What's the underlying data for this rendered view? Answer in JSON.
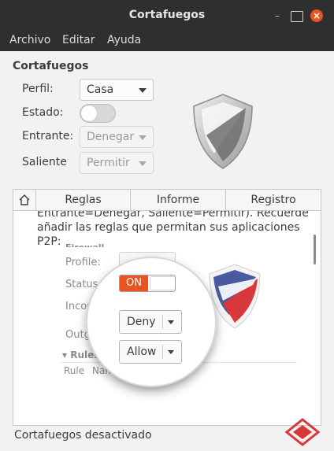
{
  "window": {
    "title": "Cortafuegos",
    "minimize_glyph": "–",
    "close_glyph": "×"
  },
  "menu": {
    "items": [
      "Archivo",
      "Editar",
      "Ayuda"
    ]
  },
  "settings": {
    "section_title": "Cortafuegos",
    "profile_label": "Perfil:",
    "profile_value": "Casa",
    "status_label": "Estado:",
    "status_on": false,
    "incoming_label": "Entrante:",
    "incoming_value": "Denegar",
    "outgoing_label": "Saliente",
    "outgoing_value": "Permitir"
  },
  "tabs": {
    "home_icon": "home-icon",
    "items": [
      "Reglas",
      "Informe",
      "Registro"
    ]
  },
  "panel": {
    "lines": [
      "Entrante=Denegar, Saliente=Permitir). Recuerde",
      "añadir las reglas que permitan sus aplicaciones",
      "P2P:"
    ],
    "embedded_screenshot": {
      "heading": "Firewall",
      "profile_label": "Profile:",
      "status_label": "Status:",
      "incoming_label": "Incoming:",
      "outgoing_label": "Outgoing:",
      "status_toggle": "ON",
      "incoming_value": "Deny",
      "outgoing_value": "Allow",
      "rules_heading": "▾ Rules",
      "rules_columns": [
        "Rule",
        "Name"
      ]
    }
  },
  "statusbar": {
    "text": "Cortafuegos desactivado"
  },
  "colors": {
    "accent": "#e95420",
    "titlebar": "#2f2f2f",
    "shield_red": "#d9383a",
    "shield_blue": "#2c3e91"
  }
}
